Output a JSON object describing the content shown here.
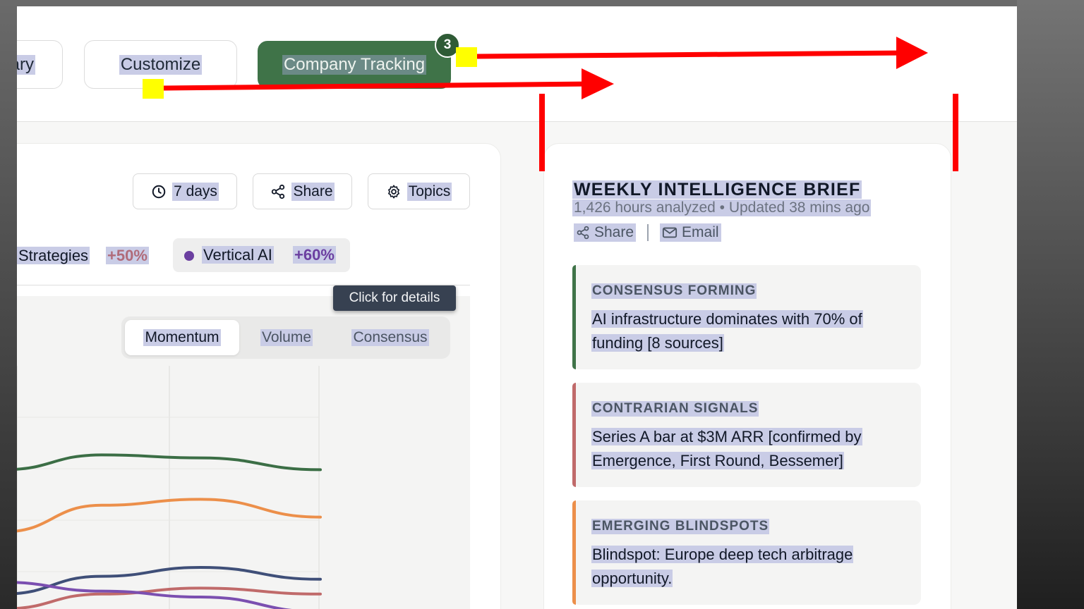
{
  "tabs": {
    "summary_label": "ary",
    "customize_label": "Customize",
    "company_label": "Company Tracking",
    "company_badge": "3"
  },
  "toolbar": {
    "days_label": "7 days",
    "share_label": "Share",
    "topics_label": "Topics"
  },
  "segments": {
    "strategies_label": "Strategies",
    "strategies_pct": "+50%",
    "vertical_label": "Vertical AI",
    "vertical_pct": "+60%"
  },
  "tooltip": "Click for details",
  "chart_toggle": {
    "momentum": "Momentum",
    "volume": "Volume",
    "consensus": "Consensus"
  },
  "chart_data": {
    "type": "line",
    "series": [
      {
        "color": "#3b6e45",
        "values": [
          0.78,
          0.83,
          0.82,
          0.78
        ]
      },
      {
        "color": "#ec8f4a",
        "values": [
          0.57,
          0.66,
          0.68,
          0.62
        ]
      },
      {
        "color": "#3f4f78",
        "values": [
          0.36,
          0.42,
          0.45,
          0.41
        ]
      },
      {
        "color": "#c06a6a",
        "values": [
          0.31,
          0.36,
          0.38,
          0.36
        ]
      },
      {
        "color": "#7b4fb0",
        "values": [
          0.4,
          0.37,
          0.35,
          0.3
        ]
      }
    ],
    "grid": true
  },
  "brief": {
    "title": "WEEKLY INTELLIGENCE BRIEF",
    "subtitle": "1,426 hours analyzed • Updated 38 mins ago",
    "share_label": "Share",
    "email_label": "Email",
    "cards": [
      {
        "heading": "CONSENSUS FORMING",
        "body": "AI infrastructure dominates with 70% of funding [8 sources]",
        "color": "#3f7348"
      },
      {
        "heading": "CONTRARIAN SIGNALS",
        "body": "Series A bar at $3M ARR [confirmed by Emergence, First Round, Bessemer]",
        "color": "#c06a6a"
      },
      {
        "heading": "EMERGING BLINDSPOTS",
        "body": "Blindspot: Europe deep tech arbitrage opportunity.",
        "color": "#ec8f4a"
      }
    ]
  },
  "annotation_colors": {
    "arrow": "#ff0000",
    "marker": "#ffff00"
  }
}
